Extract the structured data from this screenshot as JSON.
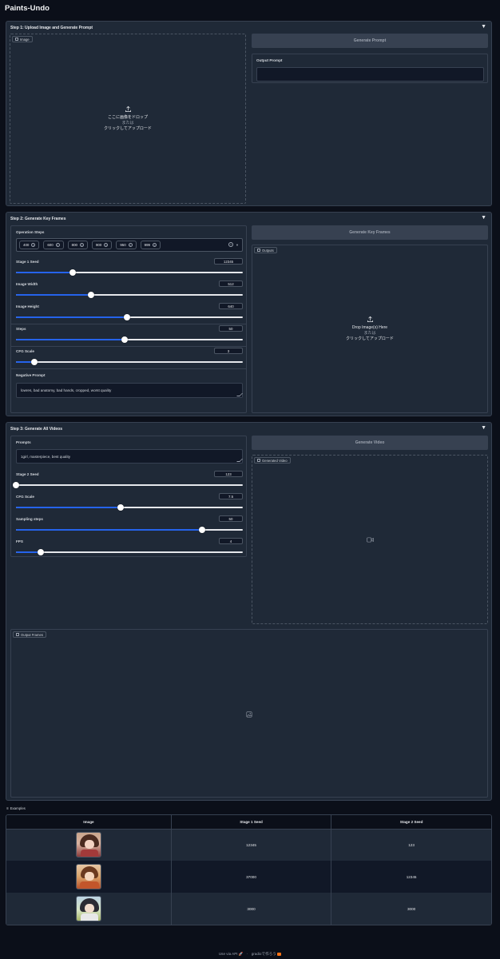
{
  "app_title": "Paints-Undo",
  "step1": {
    "header": "Step 1: Upload Image and Generate Prompt",
    "image_tag": "Image",
    "drop_line1": "ここに画像をドロップ",
    "drop_or": "または",
    "drop_line2": "クリックしてアップロード",
    "generate_prompt_button": "Generate Prompt",
    "output_prompt_label": "Output Prompt",
    "output_prompt_value": ""
  },
  "step2": {
    "header": "Step 2: Generate Key Frames",
    "operation_steps_label": "Operation Steps",
    "operation_steps": [
      "400",
      "600",
      "800",
      "900",
      "950",
      "999"
    ],
    "sliders": [
      {
        "label": "Stage 1 Seed",
        "value": "12345",
        "fraction": 0.25
      },
      {
        "label": "Image Width",
        "value": "512",
        "fraction": 0.33
      },
      {
        "label": "Image Height",
        "value": "640",
        "fraction": 0.49
      },
      {
        "label": "Steps",
        "value": "50",
        "fraction": 0.48
      },
      {
        "label": "CFG Scale",
        "value": "3",
        "fraction": 0.08
      }
    ],
    "negative_prompt_label": "Negative Prompt",
    "negative_prompt_value": "lowres, bad anatomy, bad hands, cropped, worst quality",
    "generate_key_frames_button": "Generate Key Frames",
    "outputs_tag": "Outputs",
    "drop_line1": "Drop Image(s) Here",
    "drop_or": "または",
    "drop_line2": "クリックしてアップロード"
  },
  "step3": {
    "header": "Step 3: Generate All Videos",
    "prompts_label": "Prompts",
    "prompts_value": "1girl, masterpiece, best quality",
    "sliders": [
      {
        "label": "Stage 2 Seed",
        "value": "123",
        "fraction": 0.0
      },
      {
        "label": "CFG Scale",
        "value": "7.5",
        "fraction": 0.46
      },
      {
        "label": "Sampling steps",
        "value": "50",
        "fraction": 0.82
      },
      {
        "label": "FPS",
        "value": "4",
        "fraction": 0.11
      }
    ],
    "generate_video_button": "Generate Video",
    "generated_video_tag": "Generated Video",
    "output_frames_tag": "Output Frames"
  },
  "examples": {
    "label": "Examples",
    "headers": [
      "Image",
      "Stage 1 Seed",
      "Stage 2 Seed"
    ],
    "rows": [
      {
        "stage1": "12345",
        "stage2": "123"
      },
      {
        "stage1": "37000",
        "stage2": "12345"
      },
      {
        "stage1": "3000",
        "stage2": "3000"
      }
    ]
  },
  "footer": {
    "api_text": "Use via API",
    "separator": "·",
    "built_with": "gradioで作ろう"
  },
  "colors": {
    "background": "#0b0f19",
    "panel": "#1f2937",
    "accent": "#2563eb"
  }
}
